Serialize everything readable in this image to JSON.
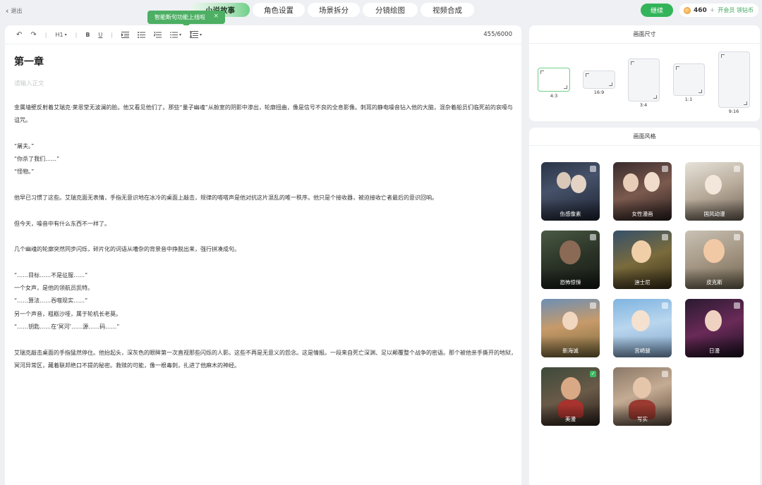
{
  "topbar": {
    "exit_label": "退出",
    "tabs": [
      "小说故事",
      "角色设置",
      "场景拆分",
      "分镜绘图",
      "视频合成"
    ],
    "tooltip_text": "智能断句功能上线啦",
    "tooltip_close": "×",
    "continue_label": "继续",
    "coin_count": "460",
    "coin_plus": "+",
    "vip_text": "开会员 领钻币"
  },
  "toolbar": {
    "undo": "↶",
    "redo": "↷",
    "heading": "H1",
    "bold": "B",
    "underline": "U",
    "word_count": "455/6000"
  },
  "editor": {
    "chapter_title": "第一章",
    "placeholder": "请输入正文",
    "paragraphs": [
      "金属墙壁反射着艾瑞克·莱恩堂无波澜的脸。他又看见他们了。那些“量子幽魂”从舱室的阴影中渗出，轮廓扭曲，像是信号不良的全息影像。刺耳的静电噪音钻入他的大脑，混杂着船员们临死前的哀嚎与诅咒。",
      "",
      "“屠夫。”",
      "“你杀了我们……”",
      "“怪物。”",
      "",
      "他早已习惯了这些。艾瑞克面无表情，手指无意识地在冰冷的桌面上敲击，规律的嗒嗒声是他对抗这片混乱的唯一秩序。他只是个接收器，被迫接收亡者最后的意识回响。",
      "",
      "但今天，噪音中有什么东西不一样了。",
      "",
      "几个幽魂的轮廓突然同步闪烁，碎片化的词语从嘈杂的背景音中挣脱出来，强行拼凑成句。",
      "",
      "“……目标……不是征服……”",
      "一个女声，是他的领航员凯特。",
      "“……算法……吞噬现实……”",
      "另一个声音，粗粝沙哑，属于轮机长老莫。",
      "“……钥匙……在‘冥河’……源……码……”",
      "",
      "艾瑞克敲击桌面的手指猛然停住。他抬起头，深灰色的眼眸第一次直视那些闪烁的人影。这些不再是无意义的怨念。这是情报。一段来自死亡深渊、足以颠覆整个战争的密语。那个被他亲手撕开的地狱，冥河异常区，藏着联邦绝口不提的秘密。救赎的可能，像一根毒刺，扎进了他麻木的神经。"
    ]
  },
  "size_panel": {
    "title": "画面尺寸",
    "ratios": [
      "4:3",
      "16:9",
      "3:4",
      "1:1",
      "9:16"
    ],
    "selected": "4:3"
  },
  "style_panel": {
    "title": "画面风格",
    "styles": [
      "伤感像素",
      "女性漫画",
      "国风动漫",
      "恐怖惊悚",
      "迪士尼",
      "皮克斯",
      "新海诚",
      "宫崎骏",
      "日漫",
      "美漫",
      "写实"
    ],
    "selected": "美漫"
  }
}
